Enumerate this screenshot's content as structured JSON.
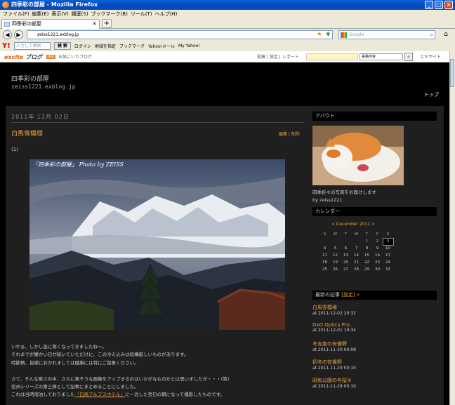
{
  "window": {
    "title": "四季彩の部屋 - Mozilla Firefox"
  },
  "menu": [
    "ファイル(F)",
    "編集(E)",
    "表示(V)",
    "履歴(S)",
    "ブックマーク(B)",
    "ツール(T)",
    "ヘルプ(H)"
  ],
  "tab": {
    "label": "四季彩の部屋"
  },
  "nav": {
    "url": "zeiss1221.exblog.jp",
    "search_placeholder": "Google"
  },
  "yahoo": {
    "search_placeholder": "入力して検索",
    "search_button": "検 索",
    "items": [
      "ログイン",
      "地域を指定",
      "ブックマーク",
      "Yahoo!メール",
      "My Yahoo!"
    ]
  },
  "excite": {
    "logo": "excite",
    "logo_suffix": "ブログ",
    "new_badge": "NEW",
    "favorites": "お気にいりブログ",
    "links": "投稿 | 設定 | レポート",
    "select": "投稿内容",
    "site": "エキサイト"
  },
  "blog": {
    "title": "四季彩の部屋",
    "url": "zeiss1221.exblog.jp",
    "top_link": "トップ"
  },
  "post": {
    "date": "2011年 12月 02日",
    "title": "白馬雪模様",
    "edit": "編集 | 削除",
    "number": "(1)",
    "caption": "「四季彩の部屋」 Photo by ZEISS",
    "paragraphs": [
      "いやぁ、しかし急に寒くなってきましたね～。",
      "それまでが暖かい日が続いていただけに、この冷え込みは結構厳しいものがあります。",
      "時節柄、皆様におかれましては健康には特にご留意ください。",
      "",
      "さて、そんな寒さの中、さらに寒そうな画像をアップするのはいかがなものかとは思いましたが・・・(笑)",
      "信州シリーズの第三弾として記事にまとめることにしました。"
    ],
    "last_pre": "これは当時宿泊しておりました",
    "last_link": "「白馬アルプスホテル」",
    "last_post": "に一泊した翌日の朝になって撮影したものです。"
  },
  "sidebar": {
    "about_header": "アバウト",
    "about_text": "四季折々の写真をお届けします",
    "about_by": "by zeiss1221",
    "calendar_header": "カレンダー",
    "calendar_month": "< December 2011 >",
    "weekdays": [
      "S",
      "M",
      "T",
      "W",
      "T",
      "F",
      "S"
    ],
    "weeks": [
      [
        "",
        "",
        "",
        "",
        "1",
        "2",
        "3"
      ],
      [
        "4",
        "5",
        "6",
        "7",
        "8",
        "9",
        "10"
      ],
      [
        "11",
        "12",
        "13",
        "14",
        "15",
        "16",
        "17"
      ],
      [
        "18",
        "19",
        "20",
        "21",
        "22",
        "23",
        "24"
      ],
      [
        "25",
        "26",
        "27",
        "28",
        "29",
        "30",
        "31"
      ]
    ],
    "recent_header": "最新の記事",
    "recent_setting": "[設定] »",
    "recent": [
      {
        "title": "白馬雪模様",
        "time": "at 2011-12-02 20:32"
      },
      {
        "title": "DxO Optics Pro..",
        "time": "at 2011-12-01 19:34"
      },
      {
        "title": "冬支度の安曇野",
        "time": "at 2011-11-30 00:08"
      },
      {
        "title": "初冬の安曇野",
        "time": "at 2011-11-29 00:10"
      },
      {
        "title": "昭和公園の冬桜③",
        "time": "at 2011-11-28 00:10"
      }
    ]
  }
}
